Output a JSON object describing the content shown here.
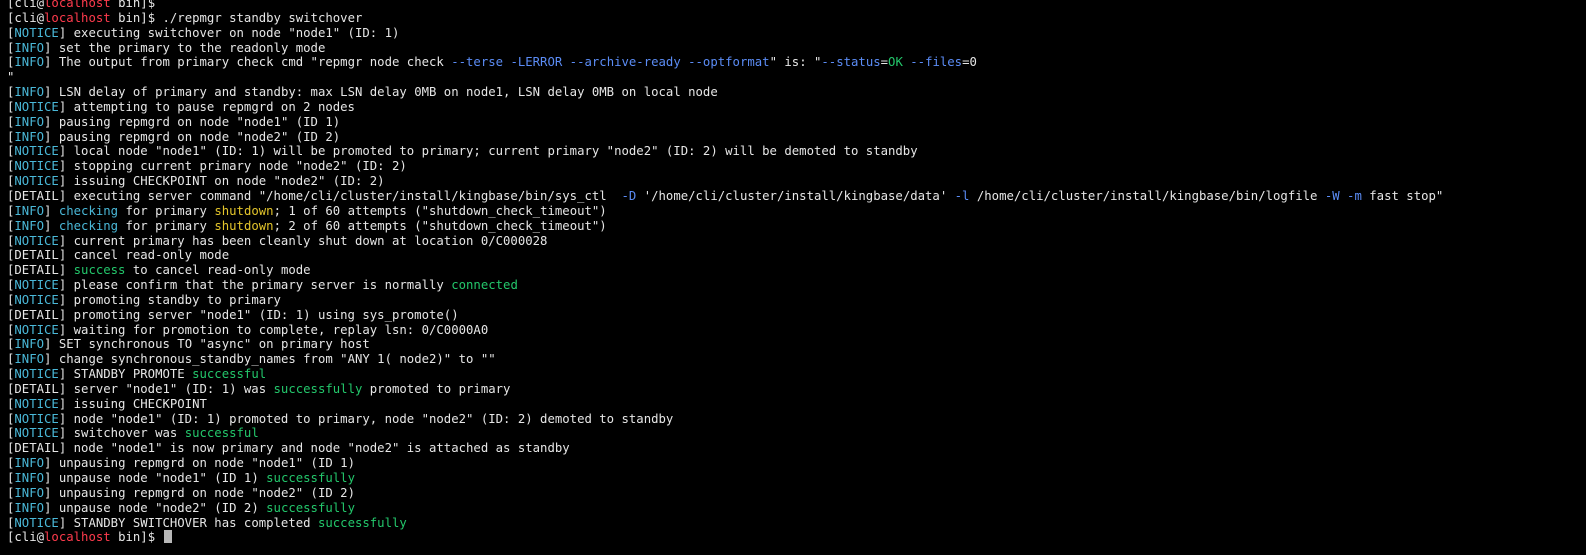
{
  "colors": {
    "background": "#000000",
    "default": "#e6e6e6",
    "tag": "#4ab8d8",
    "host": "#ff3b4d",
    "option": "#5b8cf5",
    "success": "#23c76b",
    "warn": "#e3c52b",
    "cursor": "#b8b8b8"
  },
  "lines": [
    [
      {
        "t": "[cli@",
        "c": "default"
      },
      {
        "t": "localhost",
        "c": "host"
      },
      {
        "t": " bin]$",
        "c": "default"
      }
    ],
    [
      {
        "t": "[cli@",
        "c": "default"
      },
      {
        "t": "localhost",
        "c": "host"
      },
      {
        "t": " bin]$ ./repmgr standby switchover",
        "c": "default"
      }
    ],
    [
      {
        "t": "[",
        "c": "default"
      },
      {
        "t": "NOTICE",
        "c": "tag"
      },
      {
        "t": "] executing switchover on node \"node1\" (ID: 1)",
        "c": "default"
      }
    ],
    [
      {
        "t": "[",
        "c": "default"
      },
      {
        "t": "INFO",
        "c": "tag"
      },
      {
        "t": "] set the primary to the readonly mode",
        "c": "default"
      }
    ],
    [
      {
        "t": "[",
        "c": "default"
      },
      {
        "t": "INFO",
        "c": "tag"
      },
      {
        "t": "] The output from primary check cmd \"repmgr node check ",
        "c": "default"
      },
      {
        "t": "--terse -LERROR --archive-ready --optformat",
        "c": "option"
      },
      {
        "t": "\" is: \"",
        "c": "default"
      },
      {
        "t": "--status",
        "c": "option"
      },
      {
        "t": "=",
        "c": "default"
      },
      {
        "t": "OK",
        "c": "success"
      },
      {
        "t": " ",
        "c": "default"
      },
      {
        "t": "--files",
        "c": "option"
      },
      {
        "t": "=0",
        "c": "default"
      }
    ],
    [
      {
        "t": "\"",
        "c": "default"
      }
    ],
    [
      {
        "t": "[",
        "c": "default"
      },
      {
        "t": "INFO",
        "c": "tag"
      },
      {
        "t": "] LSN delay of primary and standby: max LSN delay 0MB on node1, LSN delay 0MB on local node",
        "c": "default"
      }
    ],
    [
      {
        "t": "[",
        "c": "default"
      },
      {
        "t": "NOTICE",
        "c": "tag"
      },
      {
        "t": "] attempting to pause repmgrd on 2 nodes",
        "c": "default"
      }
    ],
    [
      {
        "t": "[",
        "c": "default"
      },
      {
        "t": "INFO",
        "c": "tag"
      },
      {
        "t": "] pausing repmgrd on node \"node1\" (ID 1)",
        "c": "default"
      }
    ],
    [
      {
        "t": "[",
        "c": "default"
      },
      {
        "t": "INFO",
        "c": "tag"
      },
      {
        "t": "] pausing repmgrd on node \"node2\" (ID 2)",
        "c": "default"
      }
    ],
    [
      {
        "t": "[",
        "c": "default"
      },
      {
        "t": "NOTICE",
        "c": "tag"
      },
      {
        "t": "] local node \"node1\" (ID: 1) will be promoted to primary; current primary \"node2\" (ID: 2) will be demoted to standby",
        "c": "default"
      }
    ],
    [
      {
        "t": "[",
        "c": "default"
      },
      {
        "t": "NOTICE",
        "c": "tag"
      },
      {
        "t": "] stopping current primary node \"node2\" (ID: 2)",
        "c": "default"
      }
    ],
    [
      {
        "t": "[",
        "c": "default"
      },
      {
        "t": "NOTICE",
        "c": "tag"
      },
      {
        "t": "] issuing CHECKPOINT on node \"node2\" (ID: 2)",
        "c": "default"
      }
    ],
    [
      {
        "t": "[DETAIL] executing server command \"/home/cli/cluster/install/kingbase/bin/sys_ctl  ",
        "c": "default"
      },
      {
        "t": "-D",
        "c": "option"
      },
      {
        "t": " '/home/cli/cluster/install/kingbase/data' ",
        "c": "default"
      },
      {
        "t": "-l",
        "c": "option"
      },
      {
        "t": " /home/cli/cluster/install/kingbase/bin/logfile ",
        "c": "default"
      },
      {
        "t": "-W -m",
        "c": "option"
      },
      {
        "t": " fast stop\"",
        "c": "default"
      }
    ],
    [
      {
        "t": "[",
        "c": "default"
      },
      {
        "t": "INFO",
        "c": "tag"
      },
      {
        "t": "] ",
        "c": "default"
      },
      {
        "t": "checking",
        "c": "tag"
      },
      {
        "t": " for primary ",
        "c": "default"
      },
      {
        "t": "shutdown",
        "c": "warn"
      },
      {
        "t": "; 1 of 60 attempts (\"shutdown_check_timeout\")",
        "c": "default"
      }
    ],
    [
      {
        "t": "[",
        "c": "default"
      },
      {
        "t": "INFO",
        "c": "tag"
      },
      {
        "t": "] ",
        "c": "default"
      },
      {
        "t": "checking",
        "c": "tag"
      },
      {
        "t": " for primary ",
        "c": "default"
      },
      {
        "t": "shutdown",
        "c": "warn"
      },
      {
        "t": "; 2 of 60 attempts (\"shutdown_check_timeout\")",
        "c": "default"
      }
    ],
    [
      {
        "t": "[",
        "c": "default"
      },
      {
        "t": "NOTICE",
        "c": "tag"
      },
      {
        "t": "] current primary has been cleanly shut down at location 0/C000028",
        "c": "default"
      }
    ],
    [
      {
        "t": "[DETAIL] cancel read-only mode",
        "c": "default"
      }
    ],
    [
      {
        "t": "[DETAIL] ",
        "c": "default"
      },
      {
        "t": "success",
        "c": "success"
      },
      {
        "t": " to cancel read-only mode",
        "c": "default"
      }
    ],
    [
      {
        "t": "[",
        "c": "default"
      },
      {
        "t": "NOTICE",
        "c": "tag"
      },
      {
        "t": "] please confirm that the primary server is normally ",
        "c": "default"
      },
      {
        "t": "connected",
        "c": "success"
      }
    ],
    [
      {
        "t": "[",
        "c": "default"
      },
      {
        "t": "NOTICE",
        "c": "tag"
      },
      {
        "t": "] promoting standby to primary",
        "c": "default"
      }
    ],
    [
      {
        "t": "[DETAIL] promoting server \"node1\" (ID: 1) using sys_promote()",
        "c": "default"
      }
    ],
    [
      {
        "t": "[",
        "c": "default"
      },
      {
        "t": "NOTICE",
        "c": "tag"
      },
      {
        "t": "] waiting for promotion to complete, replay lsn: 0/C0000A0",
        "c": "default"
      }
    ],
    [
      {
        "t": "[",
        "c": "default"
      },
      {
        "t": "INFO",
        "c": "tag"
      },
      {
        "t": "] SET synchronous TO \"async\" on primary host",
        "c": "default"
      }
    ],
    [
      {
        "t": "[",
        "c": "default"
      },
      {
        "t": "INFO",
        "c": "tag"
      },
      {
        "t": "] change synchronous_standby_names from \"ANY 1( node2)\" to \"\"",
        "c": "default"
      }
    ],
    [
      {
        "t": "[",
        "c": "default"
      },
      {
        "t": "NOTICE",
        "c": "tag"
      },
      {
        "t": "] STANDBY PROMOTE ",
        "c": "default"
      },
      {
        "t": "successful",
        "c": "success"
      }
    ],
    [
      {
        "t": "[DETAIL] server \"node1\" (ID: 1) was ",
        "c": "default"
      },
      {
        "t": "successfully",
        "c": "success"
      },
      {
        "t": " promoted to primary",
        "c": "default"
      }
    ],
    [
      {
        "t": "[",
        "c": "default"
      },
      {
        "t": "NOTICE",
        "c": "tag"
      },
      {
        "t": "] issuing CHECKPOINT",
        "c": "default"
      }
    ],
    [
      {
        "t": "[",
        "c": "default"
      },
      {
        "t": "NOTICE",
        "c": "tag"
      },
      {
        "t": "] node \"node1\" (ID: 1) promoted to primary, node \"node2\" (ID: 2) demoted to standby",
        "c": "default"
      }
    ],
    [
      {
        "t": "[",
        "c": "default"
      },
      {
        "t": "NOTICE",
        "c": "tag"
      },
      {
        "t": "] switchover was ",
        "c": "default"
      },
      {
        "t": "successful",
        "c": "success"
      }
    ],
    [
      {
        "t": "[DETAIL] node \"node1\" is now primary and node \"node2\" is attached as standby",
        "c": "default"
      }
    ],
    [
      {
        "t": "[",
        "c": "default"
      },
      {
        "t": "INFO",
        "c": "tag"
      },
      {
        "t": "] unpausing repmgrd on node \"node1\" (ID 1)",
        "c": "default"
      }
    ],
    [
      {
        "t": "[",
        "c": "default"
      },
      {
        "t": "INFO",
        "c": "tag"
      },
      {
        "t": "] unpause node \"node1\" (ID 1) ",
        "c": "default"
      },
      {
        "t": "successfully",
        "c": "success"
      }
    ],
    [
      {
        "t": "[",
        "c": "default"
      },
      {
        "t": "INFO",
        "c": "tag"
      },
      {
        "t": "] unpausing repmgrd on node \"node2\" (ID 2)",
        "c": "default"
      }
    ],
    [
      {
        "t": "[",
        "c": "default"
      },
      {
        "t": "INFO",
        "c": "tag"
      },
      {
        "t": "] unpause node \"node2\" (ID 2) ",
        "c": "default"
      },
      {
        "t": "successfully",
        "c": "success"
      }
    ],
    [
      {
        "t": "[",
        "c": "default"
      },
      {
        "t": "NOTICE",
        "c": "tag"
      },
      {
        "t": "] STANDBY SWITCHOVER has completed ",
        "c": "default"
      },
      {
        "t": "successfully",
        "c": "success"
      }
    ],
    [
      {
        "t": "[cli@",
        "c": "default"
      },
      {
        "t": "localhost",
        "c": "host"
      },
      {
        "t": " bin]$ ",
        "c": "default"
      }
    ]
  ],
  "cursor": {
    "visible": true,
    "color_key": "cursor"
  }
}
